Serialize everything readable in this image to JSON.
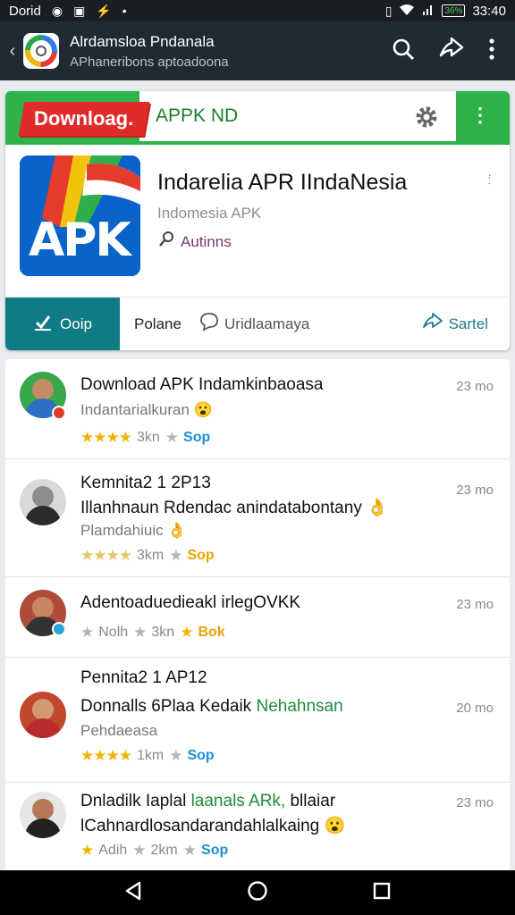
{
  "status": {
    "carrier": "Dorid",
    "battery": "36%",
    "time": "33:40",
    "icons": [
      "whatsapp-icon",
      "image-icon",
      "usb-icon",
      "dot-icon",
      "vibrate-icon",
      "wifi-icon",
      "signal-icon",
      "battery-icon"
    ]
  },
  "appbar": {
    "title": "Alrdamsloa Pndanala",
    "subtitle": "APhaneribons aptoadoona",
    "icons": [
      "back-icon",
      "search-icon",
      "share-icon",
      "more-vert-icon"
    ]
  },
  "card": {
    "badge": "Downloag.",
    "banner_title": "APPK ND",
    "app_name": "Indarelia APR IIndaNesia",
    "app_subtitle": "Indomesia APK",
    "author": "Autinns",
    "icon_text": "APK",
    "download_label": "Ooip",
    "foot_a": "Polane",
    "foot_b": "Uridlaamaya",
    "foot_c": "Sartel"
  },
  "items": [
    {
      "title": "Download APK Indamkinbaoasa",
      "line2": "Indantarialkuran 😮",
      "time": "23 mo",
      "meta_a": "3kn",
      "meta_b": "Sop",
      "stars": "3.5"
    },
    {
      "title": "Kemnita2 1 2P13",
      "line2": "Illanhnaun Rdendac anindatabontany 👌",
      "line3": "Plamdahiuic 👌",
      "time": "23 mo",
      "meta_a": "3km",
      "meta_b": "Sop",
      "stars": "3.5"
    },
    {
      "title": "Adentoaduedieakl irlegOVKK",
      "time": "23 mo",
      "meta_a": "Nolh",
      "meta_a2": "3kn",
      "meta_b": "Bok",
      "stars": "0"
    },
    {
      "title": "Pennita2 1 AP12",
      "line2_a": "Donnalls 6Plaa Kedaik ",
      "line2_b": "Nehahnsan",
      "line3": "Pehdaeasa",
      "time": "20 mo",
      "meta_a": "1km",
      "meta_b": "Sop",
      "stars": "3.5"
    },
    {
      "title_a": "Dnladilk Iaplal ",
      "title_b": "laanals ARk,",
      "title_c": " bllaiar",
      "line2": "lCahnardlosandarandahlalkaing 😮",
      "time": "23 mo",
      "meta_a": "Adih",
      "meta_a2": "2km",
      "meta_b": "Sop",
      "stars": "1"
    }
  ],
  "colors": {
    "green": "#2db34a",
    "red": "#e12a2a",
    "teal": "#0f7b84",
    "star": "#f0b400",
    "sop": "#1f8fd0"
  }
}
